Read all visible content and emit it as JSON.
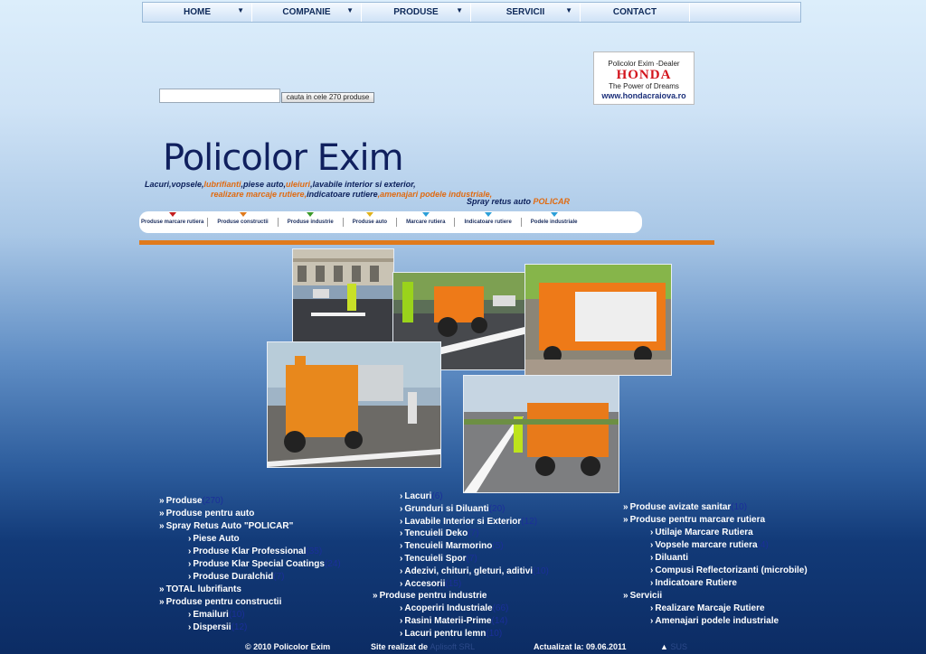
{
  "nav": {
    "items": [
      "HOME",
      "COMPANIE",
      "PRODUSE",
      "SERVICII",
      "CONTACT"
    ],
    "arrow": "▼"
  },
  "search": {
    "placeholder": "",
    "button_label": "cauta in cele 270 produse"
  },
  "honda": {
    "dealer": "Policolor Exim -Dealer",
    "brand": "HONDA",
    "slogan": "The Power of Dreams",
    "url": "www.hondacraiova.ro"
  },
  "logo": {
    "title": "Policolor Exim",
    "tag1_a": "Lacuri,vopsele,",
    "tag1_b": "lubrifianti",
    "tag1_c": ",piese auto,",
    "tag1_d": "uleiuri",
    "tag1_e": ",lavabile interior si exterior,",
    "tag2_a": "realizare marcaje rutiere,",
    "tag2_b": "indicatoare rutiere",
    "tag2_c": ",amenajari podele industriale,",
    "tag3_a": "Spray retus auto ",
    "tag3_b": "POLICAR"
  },
  "categories": [
    {
      "label": "Produse marcare rutiera",
      "color": "#c41e1e"
    },
    {
      "label": "Produse constructii",
      "color": "#e07a1c"
    },
    {
      "label": "Produse industrie",
      "color": "#3a9a2a"
    },
    {
      "label": "Produse auto",
      "color": "#e0b21c"
    },
    {
      "label": "Marcare rutiera",
      "color": "#2c9fd8"
    },
    {
      "label": "Indicatoare rutiere",
      "color": "#2c9fd8"
    },
    {
      "label": "Podele industriale",
      "color": "#2c9fd8"
    }
  ],
  "col1": [
    {
      "label": "Produse",
      "count": "(270)",
      "prefix": "»"
    },
    {
      "label": "Produse pentru auto",
      "count": "",
      "prefix": "»"
    },
    {
      "label": "Spray Retus Auto \"POLICAR\"",
      "count": "",
      "prefix": "»"
    },
    {
      "label": "Piese Auto",
      "count": "",
      "prefix": "›"
    },
    {
      "label": "Produse Klar Professional",
      "count": "(35)",
      "prefix": "›"
    },
    {
      "label": "Produse Klar Special Coatings",
      "count": "(24)",
      "prefix": "›"
    },
    {
      "label": "Produse Duralchid",
      "count": "(7)",
      "prefix": "›"
    },
    {
      "label": "TOTAL lubrifiants",
      "count": "",
      "prefix": "»"
    },
    {
      "label": "Produse pentru constructii",
      "count": "",
      "prefix": "»"
    },
    {
      "label": "Emailuri",
      "count": "(10)",
      "prefix": "›"
    },
    {
      "label": "Dispersii",
      "count": "(12)",
      "prefix": "›"
    }
  ],
  "col2": [
    {
      "label": "Lacuri",
      "count": "(6)",
      "prefix": "›"
    },
    {
      "label": "Grunduri si Diluanti",
      "count": "(20)",
      "prefix": "›"
    },
    {
      "label": "Lavabile Interior si Exterior",
      "count": "(12)",
      "prefix": "›"
    },
    {
      "label": "Tencuieli Deko",
      "count": "(7)",
      "prefix": "›"
    },
    {
      "label": "Tencuieli Marmorino",
      "count": "(5)",
      "prefix": "›"
    },
    {
      "label": "Tencuieli Spor",
      "count": "(7)",
      "prefix": "›"
    },
    {
      "label": "Adezivi, chituri, gleturi, aditivi",
      "count": "(10)",
      "prefix": "›"
    },
    {
      "label": "Accesorii",
      "count": "(15)",
      "prefix": "›"
    },
    {
      "label": "Produse pentru industrie",
      "count": "",
      "prefix": "»"
    },
    {
      "label": "Acoperiri Industriale",
      "count": "(66)",
      "prefix": "›"
    },
    {
      "label": "Rasini Materii-Prime",
      "count": "(14)",
      "prefix": "›"
    },
    {
      "label": "Lacuri pentru lemn",
      "count": "(10)",
      "prefix": "›"
    }
  ],
  "col3": [
    {
      "label": "Produse avizate sanitar",
      "count": "(10)",
      "prefix": "»"
    },
    {
      "label": "Produse pentru marcare rutiera",
      "count": "",
      "prefix": "»"
    },
    {
      "label": "Utilaje Marcare Rutiera",
      "count": "",
      "prefix": "›"
    },
    {
      "label": "Vopsele marcare rutiera",
      "count": "(4)",
      "prefix": "›"
    },
    {
      "label": "Diluanti",
      "count": "",
      "prefix": "›"
    },
    {
      "label": "Compusi Reflectorizanti (microbile)",
      "count": "",
      "prefix": "›"
    },
    {
      "label": "Indicatoare Rutiere",
      "count": "",
      "prefix": "›"
    },
    {
      "label": "Servicii",
      "count": "",
      "prefix": "»"
    },
    {
      "label": "Realizare Marcaje Rutiere",
      "count": "",
      "prefix": "›"
    },
    {
      "label": "Amenajari podele industriale",
      "count": "",
      "prefix": "›"
    }
  ],
  "footer": {
    "copyright": "© 2010 Policolor Exim",
    "made_by_label": "Site realizat de",
    "made_by": "Aplisoft SRL",
    "updated": "Actualizat la: 09.06.2011",
    "sus": "SUS",
    "sus_arrow": "▲"
  }
}
